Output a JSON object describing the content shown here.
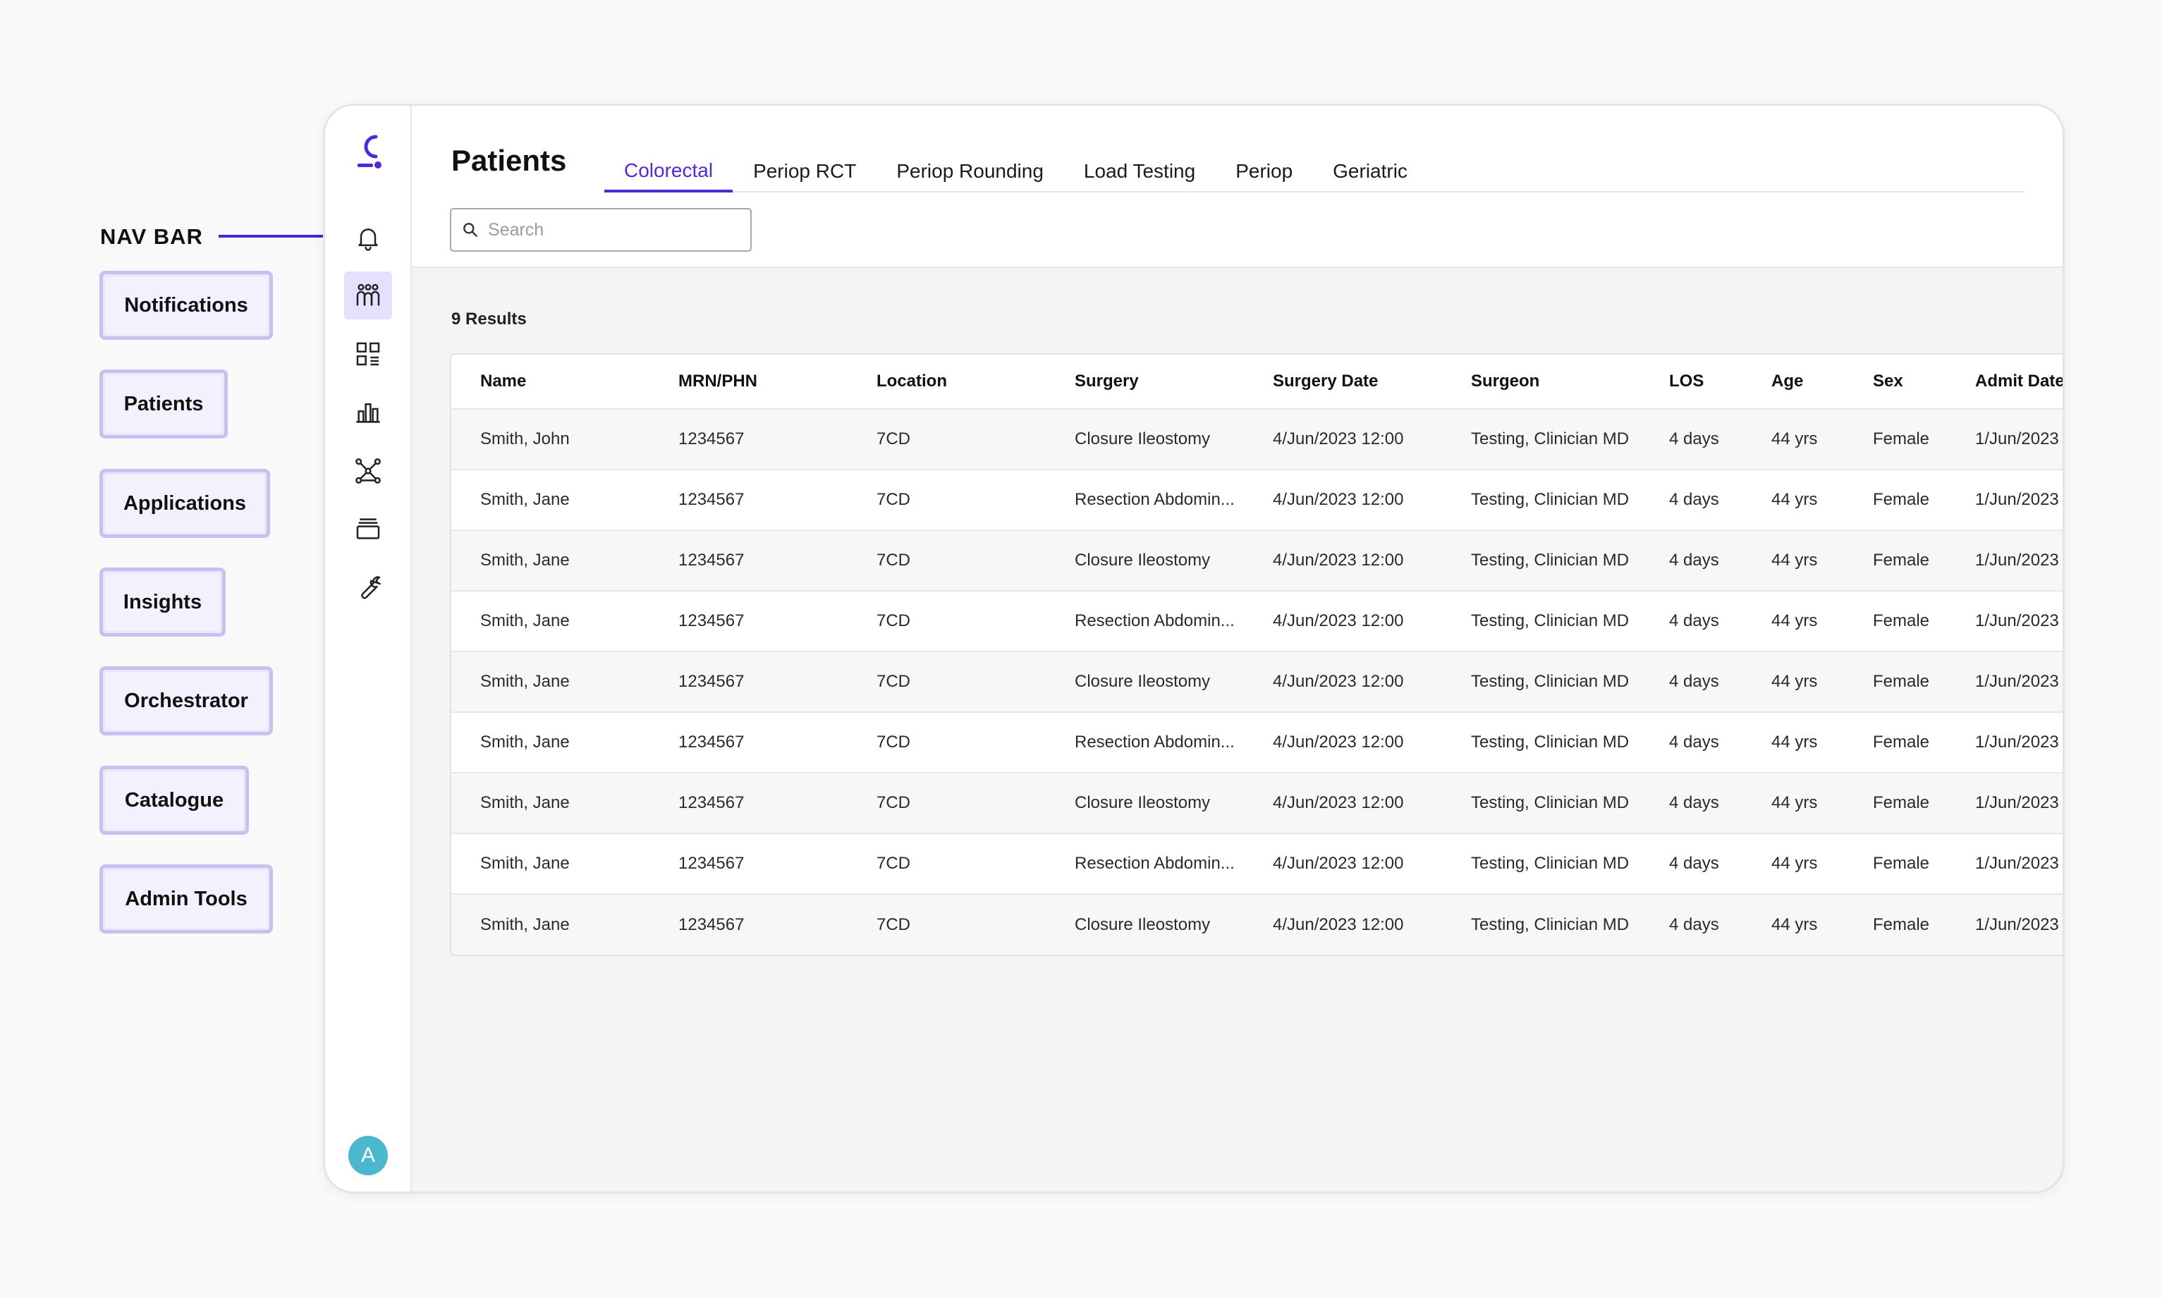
{
  "annotation": {
    "title": "NAV BAR",
    "legend": [
      "Notifications",
      "Patients",
      "Applications",
      "Insights",
      "Orchestrator",
      "Catalogue",
      "Admin Tools"
    ]
  },
  "sidebar": {
    "items": [
      {
        "icon": "bell-icon",
        "active": false
      },
      {
        "icon": "patients-icon",
        "active": true
      },
      {
        "icon": "applications-grid-icon",
        "active": false
      },
      {
        "icon": "insights-chart-icon",
        "active": false
      },
      {
        "icon": "orchestrator-network-icon",
        "active": false
      },
      {
        "icon": "catalogue-stack-icon",
        "active": false
      },
      {
        "icon": "wrench-icon",
        "active": false
      }
    ],
    "avatar_initial": "A",
    "accent": "#5328d9",
    "avatar_color": "#4bb8cf"
  },
  "header": {
    "title": "Patients",
    "tabs": [
      "Colorectal",
      "Periop RCT",
      "Periop Rounding",
      "Load Testing",
      "Periop",
      "Geriatric"
    ],
    "active_tab": "Colorectal",
    "search_placeholder": "Search"
  },
  "results": "9 Results",
  "table": {
    "columns": [
      "Name",
      "MRN/PHN",
      "Location",
      "Surgery",
      "Surgery Date",
      "Surgeon",
      "LOS",
      "Age",
      "Sex",
      "Admit Date"
    ],
    "rows": [
      [
        "Smith, John",
        "1234567",
        "7CD",
        "Closure Ileostomy",
        "4/Jun/2023 12:00",
        "Testing, Clinician MD",
        "4 days",
        "44 yrs",
        "Female",
        "1/Jun/2023"
      ],
      [
        "Smith, Jane",
        "1234567",
        "7CD",
        "Resection Abdomin...",
        "4/Jun/2023 12:00",
        "Testing, Clinician MD",
        "4 days",
        "44 yrs",
        "Female",
        "1/Jun/2023"
      ],
      [
        "Smith, Jane",
        "1234567",
        "7CD",
        "Closure Ileostomy",
        "4/Jun/2023 12:00",
        "Testing, Clinician MD",
        "4 days",
        "44 yrs",
        "Female",
        "1/Jun/2023"
      ],
      [
        "Smith, Jane",
        "1234567",
        "7CD",
        "Resection Abdomin...",
        "4/Jun/2023 12:00",
        "Testing, Clinician MD",
        "4 days",
        "44 yrs",
        "Female",
        "1/Jun/2023"
      ],
      [
        "Smith, Jane",
        "1234567",
        "7CD",
        "Closure Ileostomy",
        "4/Jun/2023 12:00",
        "Testing, Clinician MD",
        "4 days",
        "44 yrs",
        "Female",
        "1/Jun/2023"
      ],
      [
        "Smith, Jane",
        "1234567",
        "7CD",
        "Resection Abdomin...",
        "4/Jun/2023 12:00",
        "Testing, Clinician MD",
        "4 days",
        "44 yrs",
        "Female",
        "1/Jun/2023"
      ],
      [
        "Smith, Jane",
        "1234567",
        "7CD",
        "Closure Ileostomy",
        "4/Jun/2023 12:00",
        "Testing, Clinician MD",
        "4 days",
        "44 yrs",
        "Female",
        "1/Jun/2023"
      ],
      [
        "Smith, Jane",
        "1234567",
        "7CD",
        "Resection Abdomin...",
        "4/Jun/2023 12:00",
        "Testing, Clinician MD",
        "4 days",
        "44 yrs",
        "Female",
        "1/Jun/2023"
      ],
      [
        "Smith, Jane",
        "1234567",
        "7CD",
        "Closure Ileostomy",
        "4/Jun/2023 12:00",
        "Testing, Clinician MD",
        "4 days",
        "44 yrs",
        "Female",
        "1/Jun/2023"
      ]
    ]
  }
}
